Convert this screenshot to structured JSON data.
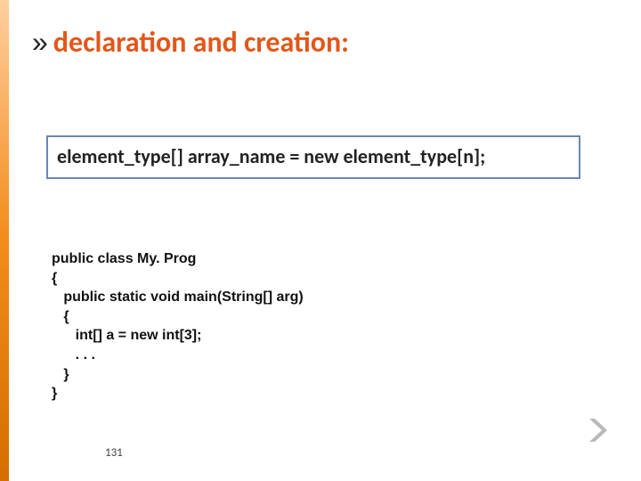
{
  "title": {
    "chevron": "»",
    "text": "declaration and creation:"
  },
  "syntax": "element_type[] array_name = new element_type[n];",
  "code": {
    "l1": "public class My. Prog",
    "l2": "{",
    "l3": "   public static void main(String[] arg)",
    "l4": "   {",
    "l5": "      int[] a = new int[3];",
    "l6": "      . . .",
    "l7": "   }",
    "l8": "}"
  },
  "page_number": "131"
}
